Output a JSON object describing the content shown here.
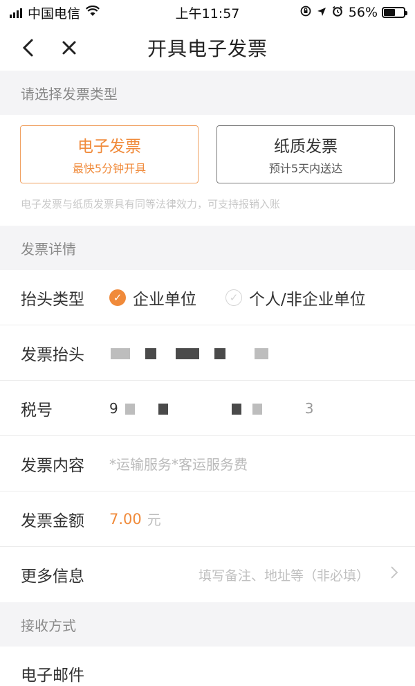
{
  "status_bar": {
    "carrier": "中国电信",
    "time": "上午11:57",
    "battery_percent": "56%",
    "battery_level": 0.56,
    "icons": [
      "signal-icon",
      "wifi-icon",
      "orientation-lock-icon",
      "location-arrow-icon",
      "alarm-icon",
      "battery-icon"
    ]
  },
  "nav": {
    "title": "开具电子发票",
    "back_icon": "chevron-left-icon",
    "close_icon": "close-icon"
  },
  "invoice_type_section": {
    "header": "请选择发票类型",
    "options": [
      {
        "label": "电子发票",
        "sub": "最快5分钟开具",
        "selected": true
      },
      {
        "label": "纸质发票",
        "sub": "预计5天内送达",
        "selected": false
      }
    ],
    "note": "电子发票与纸质发票具有同等法律效力，可支持报销入账"
  },
  "details_section": {
    "header": "发票详情",
    "title_type": {
      "label": "抬头类型",
      "options": [
        {
          "label": "企业单位",
          "checked": true
        },
        {
          "label": "个人/非企业单位",
          "checked": false
        }
      ]
    },
    "invoice_title": {
      "label": "发票抬头"
    },
    "tax_number": {
      "label": "税号",
      "prefix": "9",
      "suffix": "3"
    },
    "content": {
      "label": "发票内容",
      "value": "*运输服务*客运服务费"
    },
    "amount": {
      "label": "发票金额",
      "value": "7.00",
      "unit": "元"
    },
    "more_info": {
      "label": "更多信息",
      "hint": "填写备注、地址等（非必填）"
    }
  },
  "receive_section": {
    "header": "接收方式",
    "email": {
      "label": "电子邮件"
    }
  },
  "colors": {
    "accent": "#f08a3a",
    "section_bg": "#f4f4f6",
    "placeholder": "#bbbbbb"
  }
}
